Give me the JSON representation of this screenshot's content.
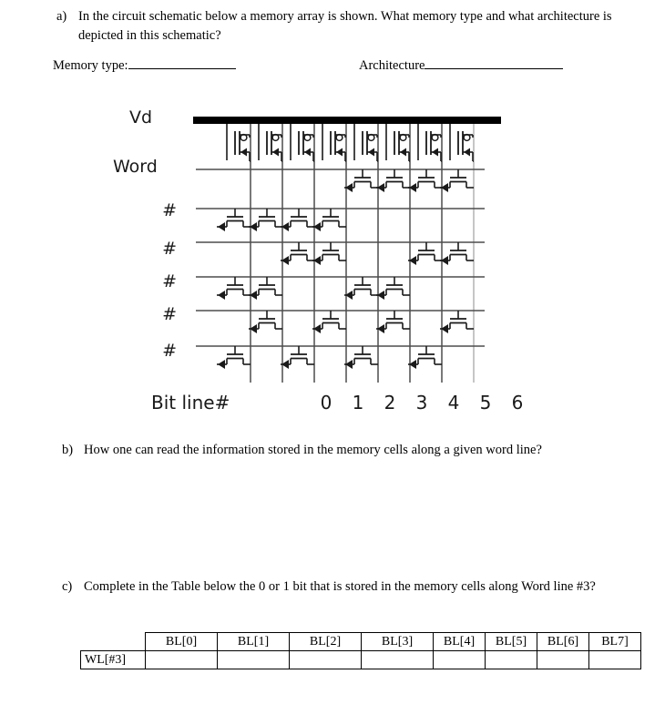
{
  "question_a": {
    "marker": "a)",
    "text": "In the circuit schematic below a memory array is shown. What memory type and what architecture is depicted in this schematic?"
  },
  "fill_ins": {
    "memory_type_label": "Memory type:",
    "architecture_label": "Architecture"
  },
  "question_b": {
    "marker": "b)",
    "text": "How one can read the information stored in the memory cells along a given word line?"
  },
  "question_c": {
    "marker": "c)",
    "text": "Complete in the Table below the 0 or 1 bit that is stored in the memory cells along Word line #3?"
  },
  "schematic": {
    "supply_label": "Vd",
    "row_labels": [
      "Word",
      "#",
      "#",
      "#",
      "#",
      "#"
    ],
    "bitline_caption": "Bit line#",
    "bitline_numbers": [
      "0",
      "1",
      "2",
      "3",
      "4",
      "5",
      "6"
    ],
    "colors": {
      "rail": "#000000",
      "wire": "#4d4d4d",
      "device": "#1a1a1a",
      "faint_wire": "#b3b3b3"
    },
    "pullup_count": 8,
    "pullup_type": "pmos-diode-load",
    "cell_type": "nmos",
    "cell_matrix": [
      [
        0,
        0,
        0,
        0,
        1,
        1,
        1,
        1
      ],
      [
        1,
        1,
        1,
        1,
        0,
        0,
        0,
        0
      ],
      [
        0,
        0,
        1,
        1,
        0,
        0,
        1,
        1
      ],
      [
        1,
        1,
        0,
        0,
        1,
        1,
        0,
        0
      ],
      [
        0,
        1,
        0,
        1,
        0,
        1,
        0,
        1
      ],
      [
        1,
        0,
        1,
        0,
        1,
        0,
        1,
        0
      ]
    ]
  },
  "answer_table": {
    "headers": [
      "",
      "BL[0]",
      "BL[1]",
      "BL[2]",
      "BL[3]",
      "BL[4]",
      "BL[5]",
      "BL[6]",
      "BL7]"
    ],
    "rows": [
      {
        "label": "WL[#3]",
        "cells": [
          "",
          "",
          "",
          "",
          "",
          "",
          "",
          ""
        ]
      }
    ]
  }
}
